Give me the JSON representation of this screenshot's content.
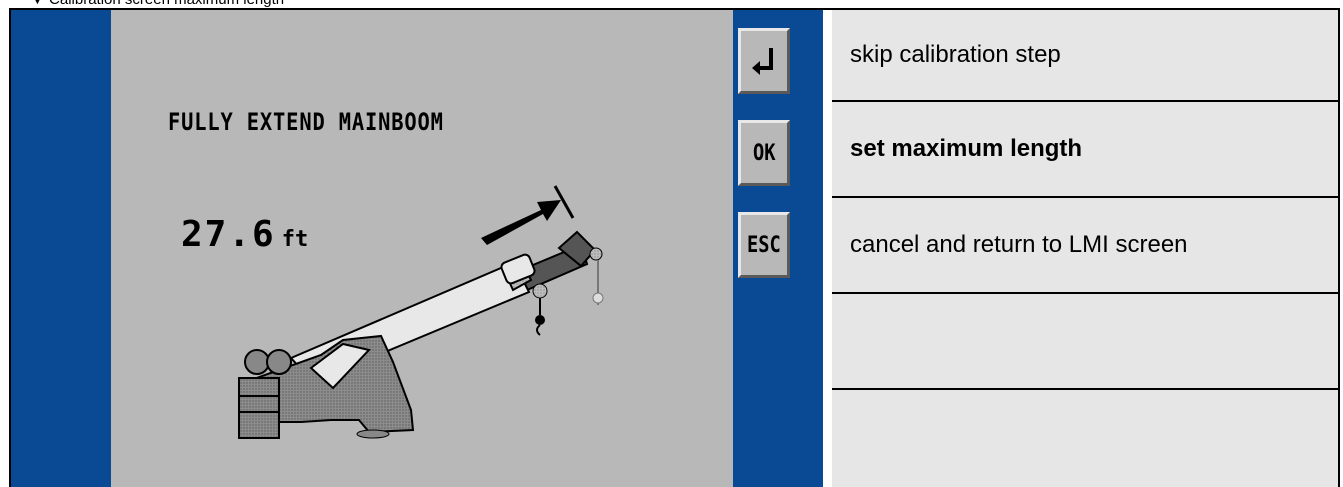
{
  "caption": "Calibration screen maximum length",
  "screen": {
    "message": "FULLY EXTEND MAINBOOM",
    "value": "27.6",
    "unit": "ft"
  },
  "buttons": [
    {
      "id": "enter",
      "label": "↵",
      "icon": "enter-icon"
    },
    {
      "id": "ok",
      "label": "OK"
    },
    {
      "id": "esc",
      "label": "ESC"
    }
  ],
  "descriptions": [
    {
      "text": "skip calibration step",
      "bold": false
    },
    {
      "text": "set maximum length",
      "bold": true
    },
    {
      "text": "cancel and return to LMI screen",
      "bold": false
    },
    {
      "text": "",
      "bold": false
    },
    {
      "text": "",
      "bold": false
    }
  ],
  "colors": {
    "screen_blue": "#0a4a95",
    "screen_gray": "#b8b8b8",
    "panel_bg": "#e6e6e6"
  }
}
